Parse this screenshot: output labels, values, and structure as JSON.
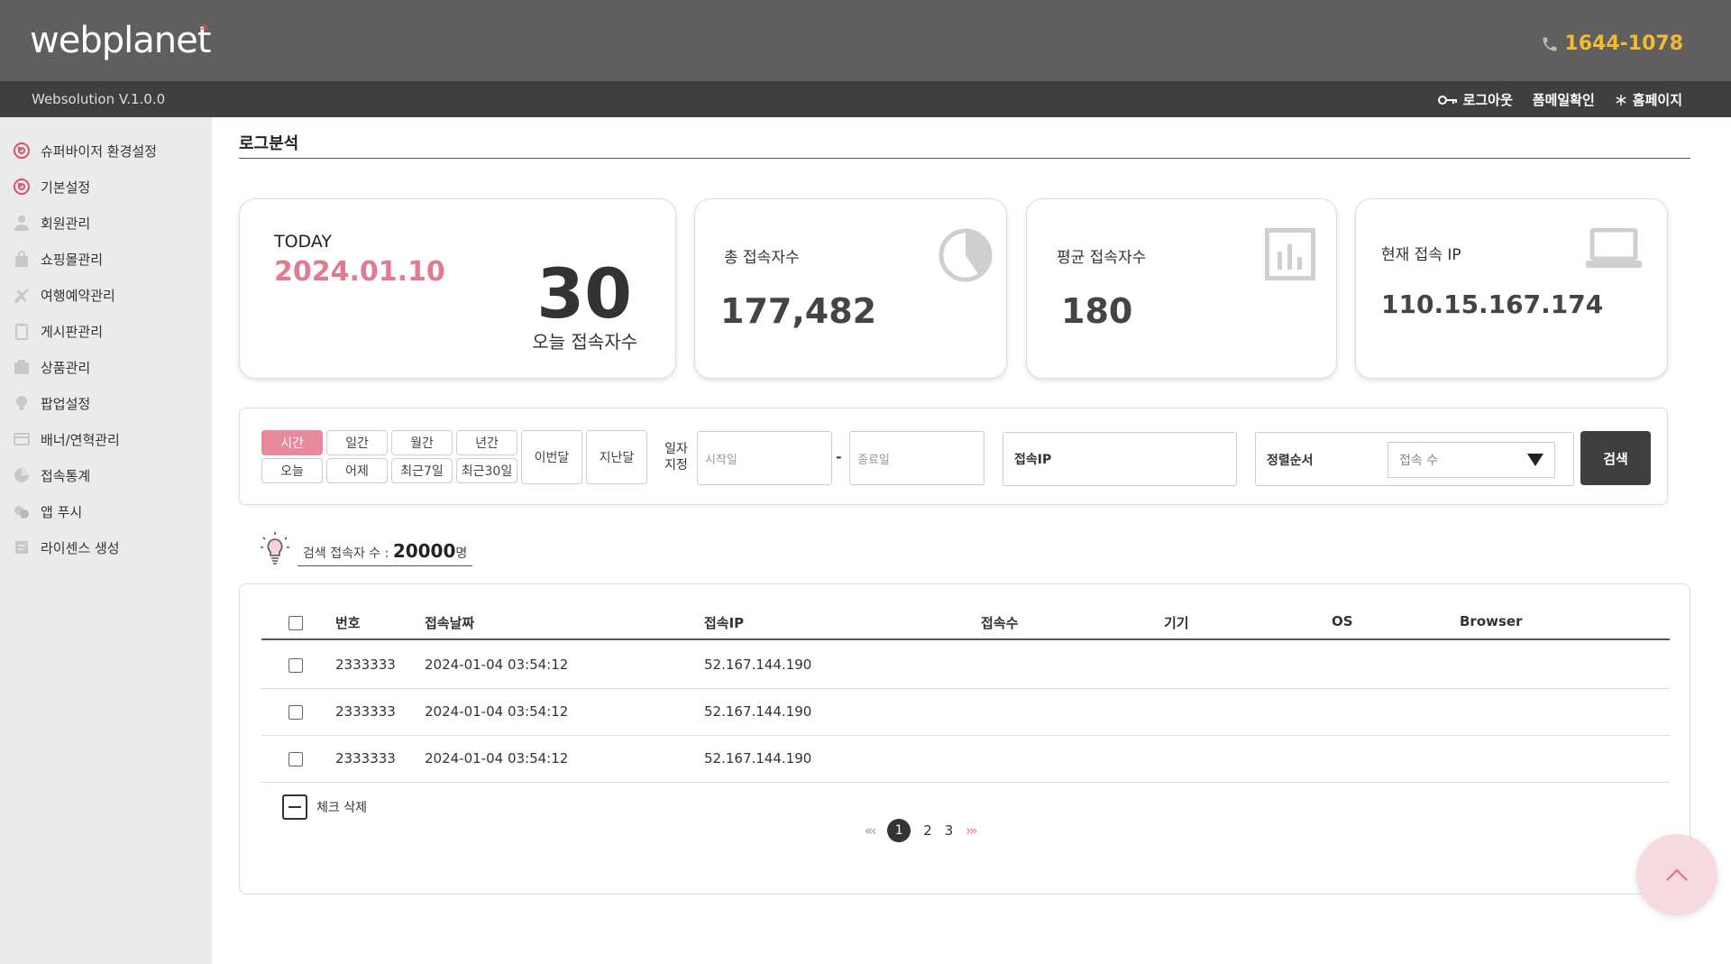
{
  "header": {
    "logo": "webplanet",
    "logo_mark": "*",
    "phone": "1644-1078",
    "phone_icon": "phone-icon",
    "version": "Websolution V.1.0.0",
    "nav": [
      {
        "label": "로그아웃",
        "icon": "key-icon"
      },
      {
        "label": "폼메일확인"
      },
      {
        "label": "홈페이지",
        "icon": "asterisk-icon"
      }
    ],
    "accent_color": "#f5b82e"
  },
  "sidebar": {
    "items": [
      {
        "label": "슈퍼바이저 환경설정",
        "icon": "settings-dial-icon"
      },
      {
        "label": "기본설정",
        "icon": "settings-dial-icon"
      },
      {
        "label": "회원관리",
        "icon": "user-icon"
      },
      {
        "label": "쇼핑몰관리",
        "icon": "shopping-bag-icon"
      },
      {
        "label": "여행예약관리",
        "icon": "airplane-icon"
      },
      {
        "label": "게시판관리",
        "icon": "clipboard-icon"
      },
      {
        "label": "상품관리",
        "icon": "box-icon"
      },
      {
        "label": "팝업설정",
        "icon": "lightbulb-icon"
      },
      {
        "label": "배너/연혁관리",
        "icon": "banner-icon"
      },
      {
        "label": "접속통계",
        "icon": "pie-chart-icon"
      },
      {
        "label": "앱 푸시",
        "icon": "app-push-icon"
      },
      {
        "label": "라이센스 생성",
        "icon": "license-icon"
      }
    ]
  },
  "page": {
    "title": "로그분석"
  },
  "stats": {
    "today_label": "TODAY",
    "today_date": "2024.01.10",
    "today_count": "30",
    "today_sub": "오늘 접속자수",
    "total_label": "총 접속자수",
    "total_value": "177,482",
    "avg_label": "평균 접속자수",
    "avg_value": "180",
    "ip_label": "현재 접속 IP",
    "ip_value": "110.15.167.174",
    "date_color": "#e07b90"
  },
  "search": {
    "periods_top": [
      "시간",
      "일간",
      "월간",
      "년간"
    ],
    "periods_bottom": [
      "오늘",
      "어제",
      "최근7일",
      "최근30일"
    ],
    "this_month": "이번달",
    "last_month": "지난달",
    "date_label": "일자 지정",
    "start_placeholder": "시작일",
    "end_placeholder": "종료일",
    "separator": "-",
    "ip_label": "접속IP",
    "sort_label": "정렬순서",
    "sort_value": "접속 수",
    "search_button": "검색",
    "active_color": "#e78a9e"
  },
  "result": {
    "prefix": "검색 접속자 수 : ",
    "count": "20000",
    "unit": "명"
  },
  "table": {
    "columns": [
      "번호",
      "접속날짜",
      "접속IP",
      "접속수",
      "기기",
      "OS",
      "Browser"
    ],
    "rows": [
      {
        "no": "2333333",
        "date": "2024-01-04 03:54:12",
        "ip": "52.167.144.190",
        "count": "",
        "device": "",
        "os": "",
        "browser": ""
      },
      {
        "no": "2333333",
        "date": "2024-01-04 03:54:12",
        "ip": "52.167.144.190",
        "count": "",
        "device": "",
        "os": "",
        "browser": ""
      },
      {
        "no": "2333333",
        "date": "2024-01-04 03:54:12",
        "ip": "52.167.144.190",
        "count": "",
        "device": "",
        "os": "",
        "browser": ""
      }
    ],
    "delete_label": "체크 삭제"
  },
  "pagination": {
    "first": "«",
    "prev": "‹",
    "pages": [
      "1",
      "2",
      "3"
    ],
    "current": "1",
    "next": "›",
    "last": "»"
  }
}
